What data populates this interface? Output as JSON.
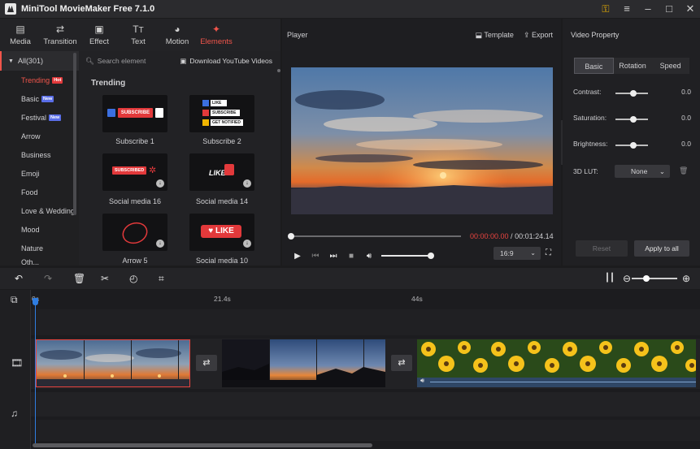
{
  "app": {
    "title": "MiniTool MovieMaker Free 7.1.0",
    "window_controls": [
      "key-icon",
      "menu-icon",
      "minimize-icon",
      "maximize-icon",
      "close-icon"
    ]
  },
  "toolbar": {
    "tabs": [
      {
        "label": "Media",
        "icon": "folder-icon"
      },
      {
        "label": "Transition",
        "icon": "transition-icon"
      },
      {
        "label": "Effect",
        "icon": "effect-icon"
      },
      {
        "label": "Text",
        "icon": "text-icon"
      },
      {
        "label": "Motion",
        "icon": "motion-icon"
      },
      {
        "label": "Elements",
        "icon": "elements-icon",
        "active": true
      }
    ]
  },
  "categories": {
    "all_label": "All(301)",
    "items": [
      {
        "label": "Trending",
        "badge": "Hot",
        "active": true
      },
      {
        "label": "Basic",
        "badge": "New"
      },
      {
        "label": "Festival",
        "badge": "New"
      },
      {
        "label": "Arrow"
      },
      {
        "label": "Business"
      },
      {
        "label": "Emoji"
      },
      {
        "label": "Food"
      },
      {
        "label": "Love & Wedding"
      },
      {
        "label": "Mood"
      },
      {
        "label": "Nature"
      },
      {
        "label": "Oth..."
      }
    ]
  },
  "elements": {
    "search_placeholder": "Search element",
    "youtube_link": "Download YouTube Videos",
    "section_title": "Trending",
    "items": [
      {
        "label": "Subscribe 1"
      },
      {
        "label": "Subscribe 2"
      },
      {
        "label": "Social media 16"
      },
      {
        "label": "Social media 14"
      },
      {
        "label": "Arrow 5"
      },
      {
        "label": "Social media 10"
      }
    ],
    "art_text": {
      "subscribe": "SUBSCRIBE",
      "like": "LIKE",
      "get_notified": "GET NOTIFIED",
      "subscribed": "SUBSCRIBED",
      "like_upper": "LIKE"
    }
  },
  "player": {
    "title": "Player",
    "template_label": "Template",
    "export_label": "Export",
    "current_time": "00:00:00.00",
    "total_time": "00:01:24.14",
    "time_separator": " / ",
    "aspect_ratio": "16:9",
    "progress": 0.0,
    "volume": 1.0
  },
  "properties": {
    "title": "Video Property",
    "tabs": [
      "Basic",
      "Rotation",
      "Speed"
    ],
    "active_tab": "Basic",
    "contrast_label": "Contrast:",
    "contrast_value": "0.0",
    "saturation_label": "Saturation:",
    "saturation_value": "0.0",
    "brightness_label": "Brightness:",
    "brightness_value": "0.0",
    "lut_label": "3D LUT:",
    "lut_value": "None",
    "reset_label": "Reset",
    "apply_label": "Apply to all"
  },
  "timeline": {
    "ruler": [
      "0s",
      "21.4s",
      "44s"
    ],
    "clips": [
      "sunset-clip-1",
      "sunset-clip-2",
      "sunflower-clip"
    ]
  },
  "colors": {
    "accent": "#f1554b",
    "playhead": "#2f7de1",
    "background": "#1b1b1d"
  }
}
